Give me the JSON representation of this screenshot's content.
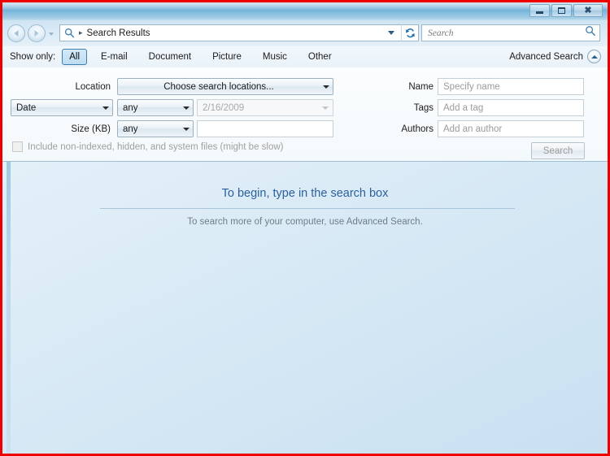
{
  "window": {
    "title": "Search Results",
    "controls": {
      "minimize": "minimize",
      "maximize": "maximize",
      "close": "close"
    }
  },
  "navbar": {
    "back": "Back",
    "forward": "Forward",
    "breadcrumb_separator": "▸",
    "breadcrumb": "Search Results",
    "address_dropdown": "History",
    "refresh": "Refresh",
    "search_placeholder": "Search"
  },
  "filterbar": {
    "show_only_label": "Show only:",
    "tabs": [
      {
        "label": "All",
        "selected": true
      },
      {
        "label": "E-mail",
        "selected": false
      },
      {
        "label": "Document",
        "selected": false
      },
      {
        "label": "Picture",
        "selected": false
      },
      {
        "label": "Music",
        "selected": false
      },
      {
        "label": "Other",
        "selected": false
      }
    ],
    "advanced_search_label": "Advanced Search",
    "advanced_search_state": "expanded"
  },
  "advanced_panel": {
    "location_label": "Location",
    "location_value": "Choose search locations...",
    "date_kind_value": "Date",
    "date_operator_value": "any",
    "date_value": "2/16/2009",
    "size_label": "Size (KB)",
    "size_operator_value": "any",
    "size_value": "",
    "name_label": "Name",
    "name_placeholder": "Specify name",
    "tags_label": "Tags",
    "tags_placeholder": "Add a tag",
    "authors_label": "Authors",
    "authors_placeholder": "Add an author",
    "include_checkbox_label": "Include non-indexed, hidden, and system files (might be slow)",
    "include_checkbox_checked": false,
    "search_button_label": "Search"
  },
  "content": {
    "headline": "To begin, type in the search box",
    "subtext": "To search more of your computer, use Advanced Search."
  },
  "colors": {
    "accent": "#2b5f9e",
    "selected_tab_border": "#3c7fb1",
    "annotation_frame": "#ee0000",
    "content_bg": "#d7e9f5"
  }
}
